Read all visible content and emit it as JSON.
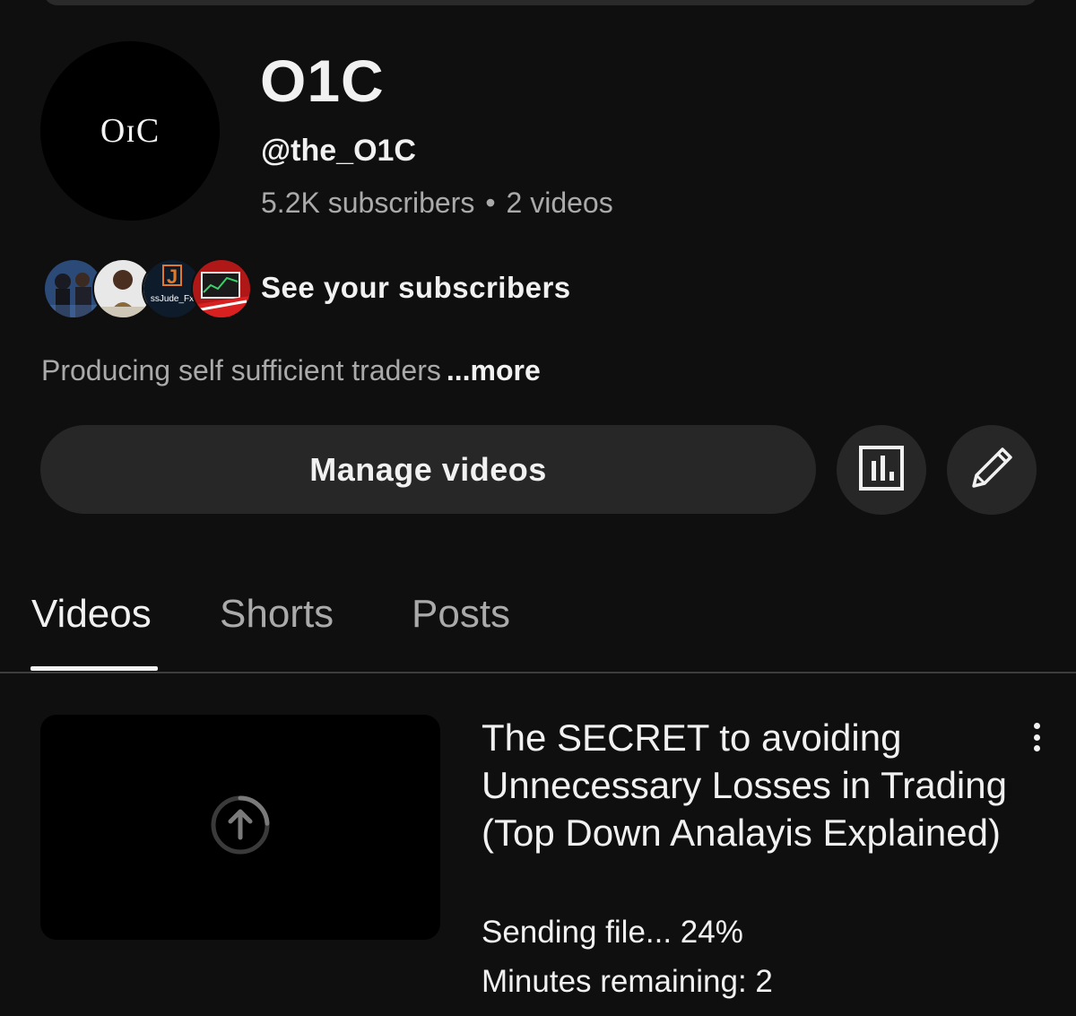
{
  "channel": {
    "avatar_text": "OɪC",
    "name": "O1C",
    "handle": "@the_O1C",
    "subscribers": "5.2K subscribers",
    "videos_count": "2 videos",
    "separator": "•",
    "see_subscribers": "See your subscribers",
    "description": "Producing self sufficient traders",
    "more": "...more",
    "subscriber_avatar_text": "ssJude_Fx"
  },
  "actions": {
    "manage_videos": "Manage videos",
    "analytics_icon": "bar-chart-icon",
    "edit_icon": "pencil-icon"
  },
  "tabs": [
    {
      "label": "Videos",
      "active": true
    },
    {
      "label": "Shorts",
      "active": false
    },
    {
      "label": "Posts",
      "active": false
    }
  ],
  "video": {
    "title": "The SECRET to avoiding Unnecessary Losses in Trading (Top Down Analayis Explained)",
    "upload_status": "Sending file... 24%",
    "upload_progress": 0.24,
    "time_remaining": "Minutes remaining: 2"
  },
  "colors": {
    "background": "#0f0f0f",
    "surface": "#272727",
    "text_primary": "#f1f1f1",
    "text_secondary": "#aaaaaa"
  }
}
